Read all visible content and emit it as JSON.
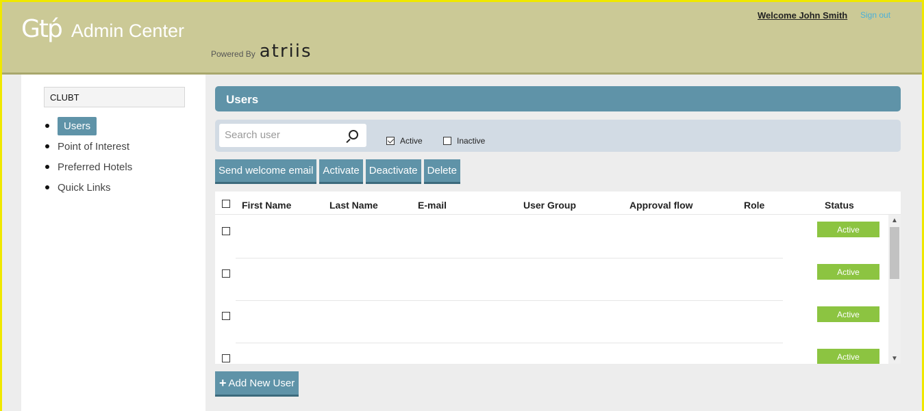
{
  "header": {
    "logo_mark": "Gtṕ",
    "app_title": "Admin Center",
    "powered_by_label": "Powered By",
    "powered_by_brand": "atriis",
    "welcome": "Welcome John Smith",
    "signout": "Sign out"
  },
  "sidebar": {
    "client": "CLUBT",
    "items": [
      {
        "label": "Users"
      },
      {
        "label": "Point of Interest"
      },
      {
        "label": "Preferred Hotels"
      },
      {
        "label": "Quick Links"
      }
    ]
  },
  "main": {
    "title": "Users",
    "search_placeholder": "Search user",
    "filter_active": "Active",
    "filter_inactive": "Inactive",
    "actions": {
      "send_welcome": "Send welcome email",
      "activate": "Activate",
      "deactivate": "Deactivate",
      "delete": "Delete"
    },
    "columns": {
      "first_name": "First Name",
      "last_name": "Last Name",
      "email": "E-mail",
      "user_group": "User Group",
      "approval_flow": "Approval flow",
      "role": "Role",
      "status": "Status"
    },
    "rows": [
      {
        "status": "Active"
      },
      {
        "status": "Active"
      },
      {
        "status": "Active"
      },
      {
        "status": "Active"
      }
    ],
    "add_user": "Add New User"
  },
  "colors": {
    "header_bg": "#cbc996",
    "accent": "#5f93a8",
    "status_active": "#8cc441",
    "frame": "#f0e800",
    "link": "#4ab0d9"
  }
}
